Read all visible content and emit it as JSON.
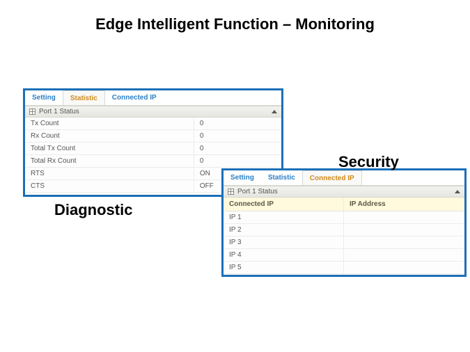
{
  "title": "Edge Intelligent Function – Monitoring",
  "labels": {
    "diagnostic": "Diagnostic",
    "security": "Security"
  },
  "diagnostic": {
    "tabs": {
      "setting": "Setting",
      "statistic": "Statistic",
      "connected_ip": "Connected IP"
    },
    "section": "Port 1 Status",
    "rows": [
      {
        "label": "Tx Count",
        "value": "0"
      },
      {
        "label": "Rx Count",
        "value": "0"
      },
      {
        "label": "Total Tx Count",
        "value": "0"
      },
      {
        "label": "Total Rx Count",
        "value": "0"
      },
      {
        "label": "RTS",
        "value": "ON"
      },
      {
        "label": "CTS",
        "value": "OFF"
      }
    ]
  },
  "security": {
    "tabs": {
      "setting": "Setting",
      "statistic": "Statistic",
      "connected_ip": "Connected IP"
    },
    "section": "Port 1 Status",
    "columns": {
      "left": "Connected IP",
      "right": "IP Address"
    },
    "rows": [
      {
        "label": "IP 1",
        "value": ""
      },
      {
        "label": "IP 2",
        "value": ""
      },
      {
        "label": "IP 3",
        "value": ""
      },
      {
        "label": "IP 4",
        "value": ""
      },
      {
        "label": "IP 5",
        "value": ""
      }
    ]
  }
}
